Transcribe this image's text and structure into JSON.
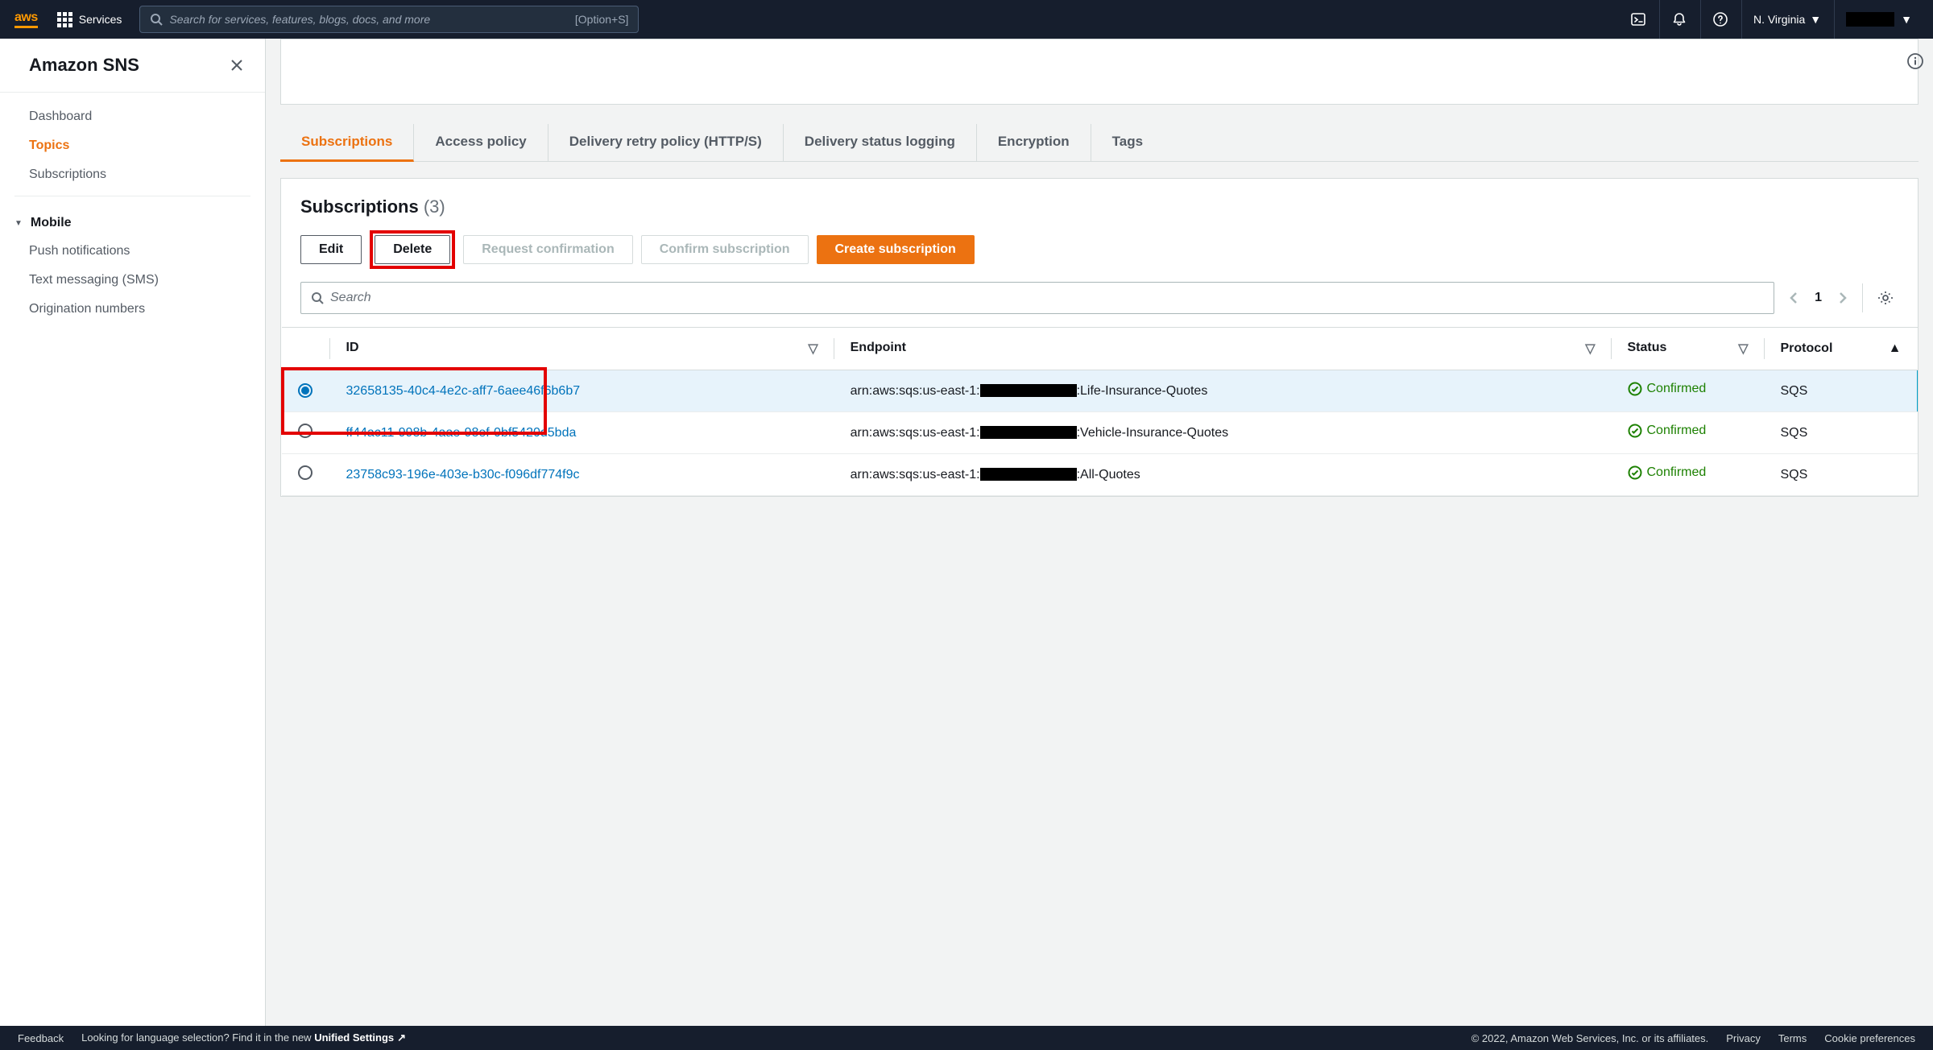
{
  "topnav": {
    "services_label": "Services",
    "search_placeholder": "Search for services, features, blogs, docs, and more",
    "search_shortcut": "[Option+S]",
    "region": "N. Virginia"
  },
  "sidebar": {
    "title": "Amazon SNS",
    "items": [
      {
        "label": "Dashboard",
        "active": false
      },
      {
        "label": "Topics",
        "active": true
      },
      {
        "label": "Subscriptions",
        "active": false
      }
    ],
    "group_label": "Mobile",
    "group_items": [
      {
        "label": "Push notifications"
      },
      {
        "label": "Text messaging (SMS)"
      },
      {
        "label": "Origination numbers"
      }
    ]
  },
  "tabs": [
    {
      "label": "Subscriptions",
      "active": true
    },
    {
      "label": "Access policy",
      "active": false
    },
    {
      "label": "Delivery retry policy (HTTP/S)",
      "active": false
    },
    {
      "label": "Delivery status logging",
      "active": false
    },
    {
      "label": "Encryption",
      "active": false
    },
    {
      "label": "Tags",
      "active": false
    }
  ],
  "panel": {
    "title": "Subscriptions",
    "count": "(3)",
    "buttons": {
      "edit": "Edit",
      "delete": "Delete",
      "request_confirmation": "Request confirmation",
      "confirm_subscription": "Confirm subscription",
      "create_subscription": "Create subscription"
    },
    "filter_placeholder": "Search",
    "page_current": "1",
    "columns": {
      "id": "ID",
      "endpoint": "Endpoint",
      "status": "Status",
      "protocol": "Protocol"
    },
    "rows": [
      {
        "selected": true,
        "id": "32658135-40c4-4e2c-aff7-6aee46f6b6b7",
        "endpoint_pre": "arn:aws:sqs:us-east-1:",
        "endpoint_post": ":Life-Insurance-Quotes",
        "status": "Confirmed",
        "protocol": "SQS"
      },
      {
        "selected": false,
        "id": "ff44ac11-998b-4aae-98ef-0bf5420d5bda",
        "endpoint_pre": "arn:aws:sqs:us-east-1:",
        "endpoint_post": ":Vehicle-Insurance-Quotes",
        "status": "Confirmed",
        "protocol": "SQS"
      },
      {
        "selected": false,
        "id": "23758c93-196e-403e-b30c-f096df774f9c",
        "endpoint_pre": "arn:aws:sqs:us-east-1:",
        "endpoint_post": ":All-Quotes",
        "status": "Confirmed",
        "protocol": "SQS"
      }
    ]
  },
  "footer": {
    "feedback": "Feedback",
    "lang_prompt": "Looking for language selection? Find it in the new ",
    "unified": "Unified Settings",
    "copyright": "© 2022, Amazon Web Services, Inc. or its affiliates.",
    "privacy": "Privacy",
    "terms": "Terms",
    "cookie": "Cookie preferences"
  }
}
